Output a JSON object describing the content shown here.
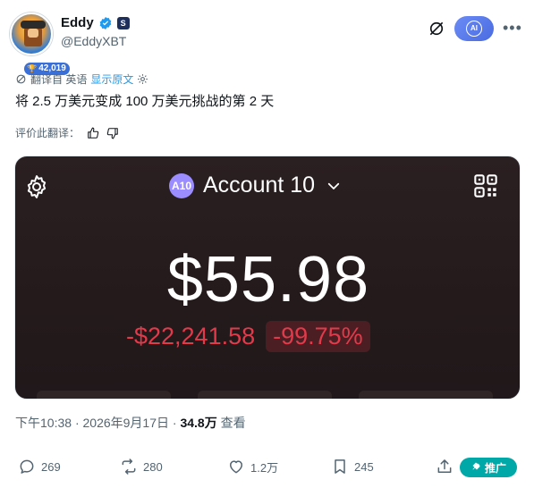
{
  "author": {
    "display_name": "Eddy",
    "handle": "@EddyXBT",
    "badge_count": "42,019",
    "aff_badge": "S"
  },
  "header_actions": {
    "grok_icon": "grok-slash-icon",
    "ai_button_label": "AI",
    "more_icon": "more-horizontal-icon"
  },
  "translation": {
    "translated_from": "翻译自 英语",
    "show_original": "显示原文",
    "rate_label": "评价此翻译："
  },
  "tweet": {
    "text": "将 2.5 万美元变成 100 万美元挑战的第 2 天"
  },
  "media": {
    "account_badge": "A10",
    "account_name": "Account 10",
    "balance": "$55.98",
    "pnl_amount": "-$22,241.58",
    "pnl_percent": "-99.75%",
    "colors": {
      "background": "#241a1c",
      "loss": "#e23a4a",
      "account_badge": "#9b8cff"
    }
  },
  "meta": {
    "time": "下午10:38",
    "date": "2026年9月17日",
    "views_count": "34.8万",
    "views_label": "查看",
    "sep": "·"
  },
  "actions": {
    "replies": "269",
    "reposts": "280",
    "likes": "1.2万",
    "bookmarks": "245",
    "promote_label": "推广"
  }
}
